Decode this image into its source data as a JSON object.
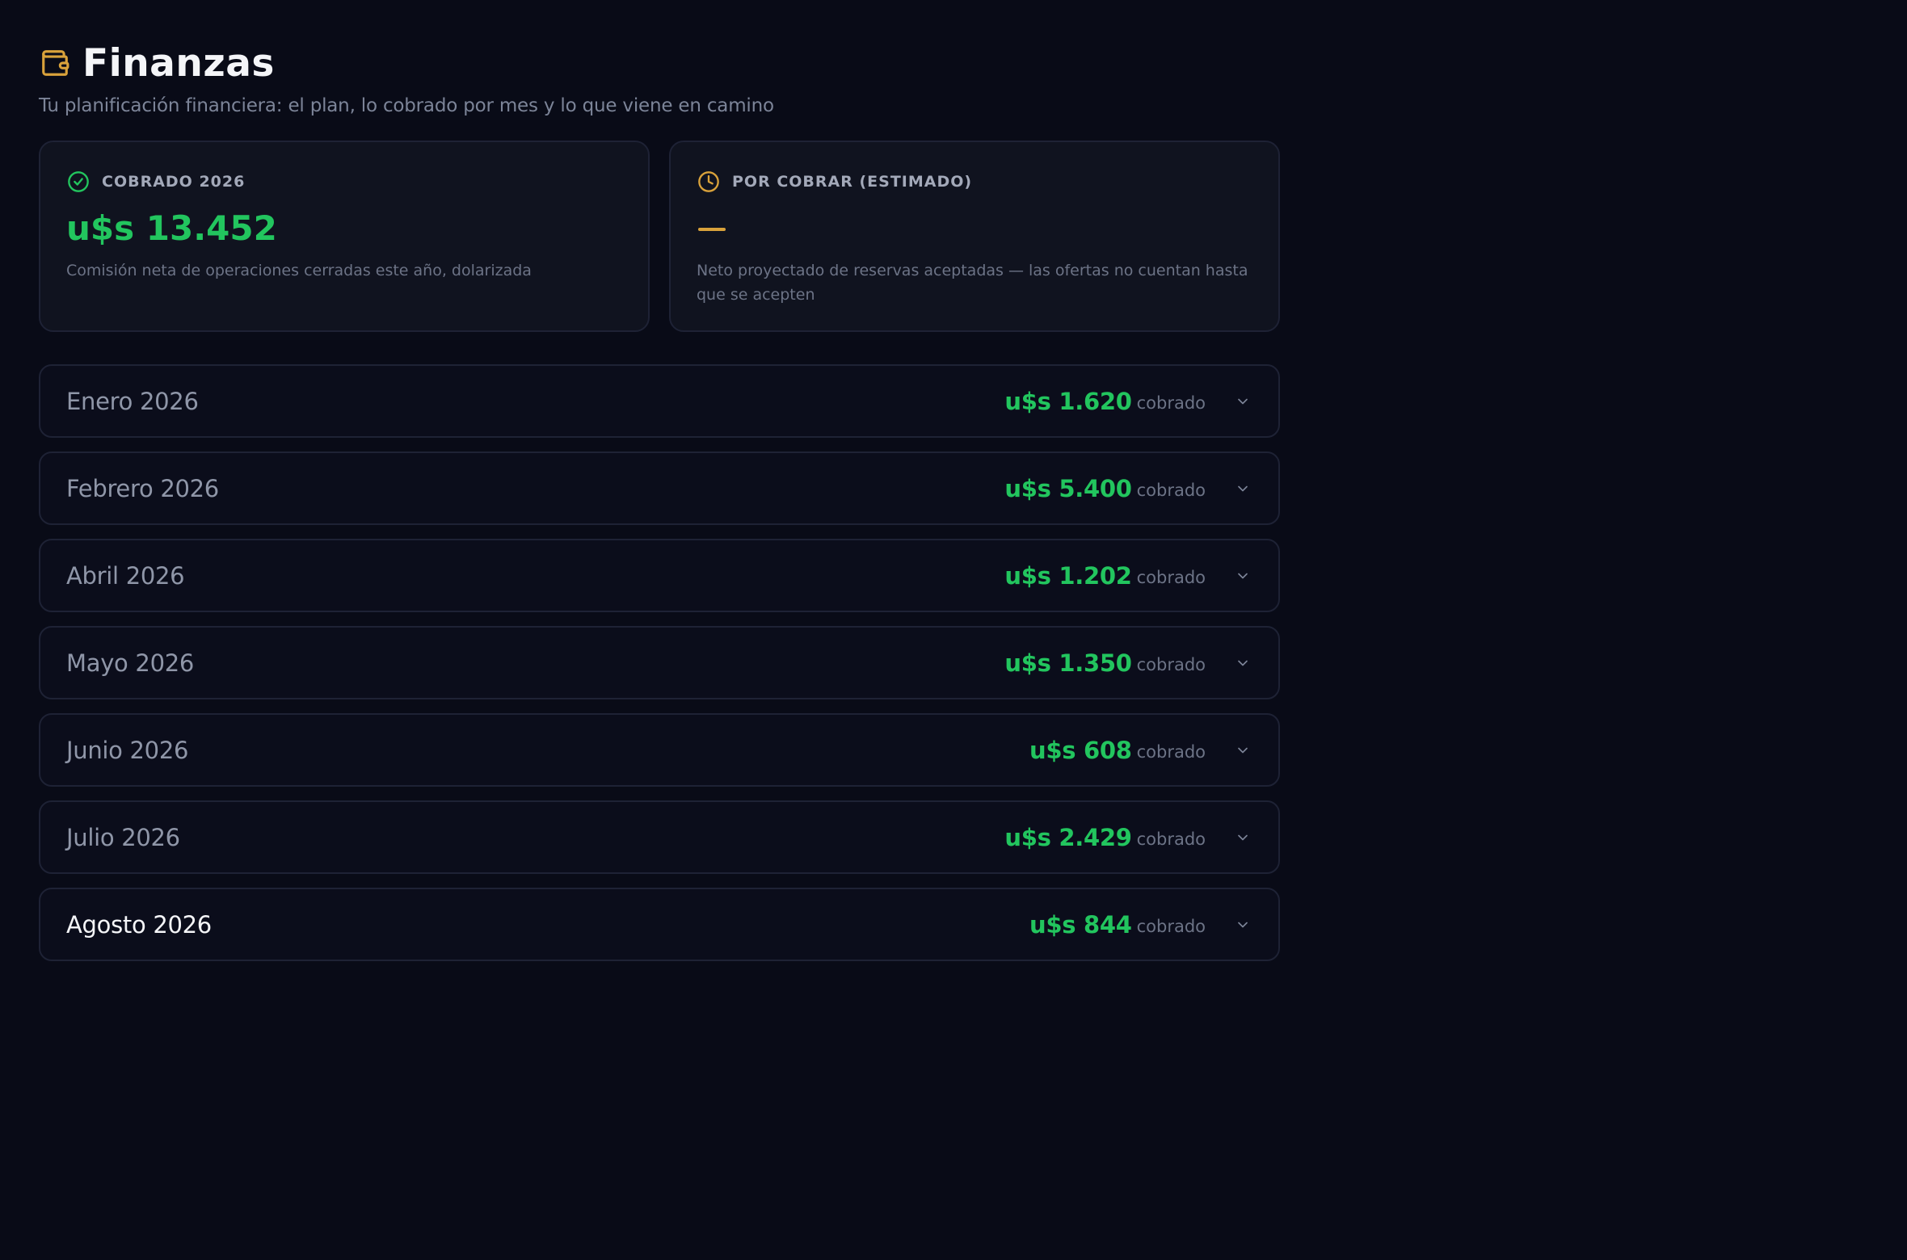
{
  "header": {
    "title": "Finanzas",
    "subtitle": "Tu planificación financiera: el plan, lo cobrado por mes y lo que viene en camino",
    "icon": "wallet-icon"
  },
  "summary": {
    "collected": {
      "label": "COBRADO 2026",
      "value": "u$s 13.452",
      "description": "Comisión neta de operaciones cerradas este año, dolarizada",
      "icon": "check-circle-icon",
      "color": "#22c55e"
    },
    "pending": {
      "label": "POR COBRAR (ESTIMADO)",
      "value": "—",
      "description": "Neto proyectado de reservas aceptadas — las ofertas no cuentan hasta que se acepten",
      "icon": "clock-icon",
      "color": "#d9a23b"
    }
  },
  "months": [
    {
      "name": "Enero 2026",
      "amount": "u$s 1.620",
      "suffix": "cobrado"
    },
    {
      "name": "Febrero 2026",
      "amount": "u$s 5.400",
      "suffix": "cobrado"
    },
    {
      "name": "Abril 2026",
      "amount": "u$s 1.202",
      "suffix": "cobrado"
    },
    {
      "name": "Mayo 2026",
      "amount": "u$s 1.350",
      "suffix": "cobrado"
    },
    {
      "name": "Junio 2026",
      "amount": "u$s 608",
      "suffix": "cobrado"
    },
    {
      "name": "Julio 2026",
      "amount": "u$s 2.429",
      "suffix": "cobrado"
    },
    {
      "name": "Agosto 2026",
      "amount": "u$s 844",
      "suffix": "cobrado"
    }
  ],
  "colors": {
    "background": "#090b17",
    "positive": "#22c55e",
    "accent": "#d9a23b"
  }
}
